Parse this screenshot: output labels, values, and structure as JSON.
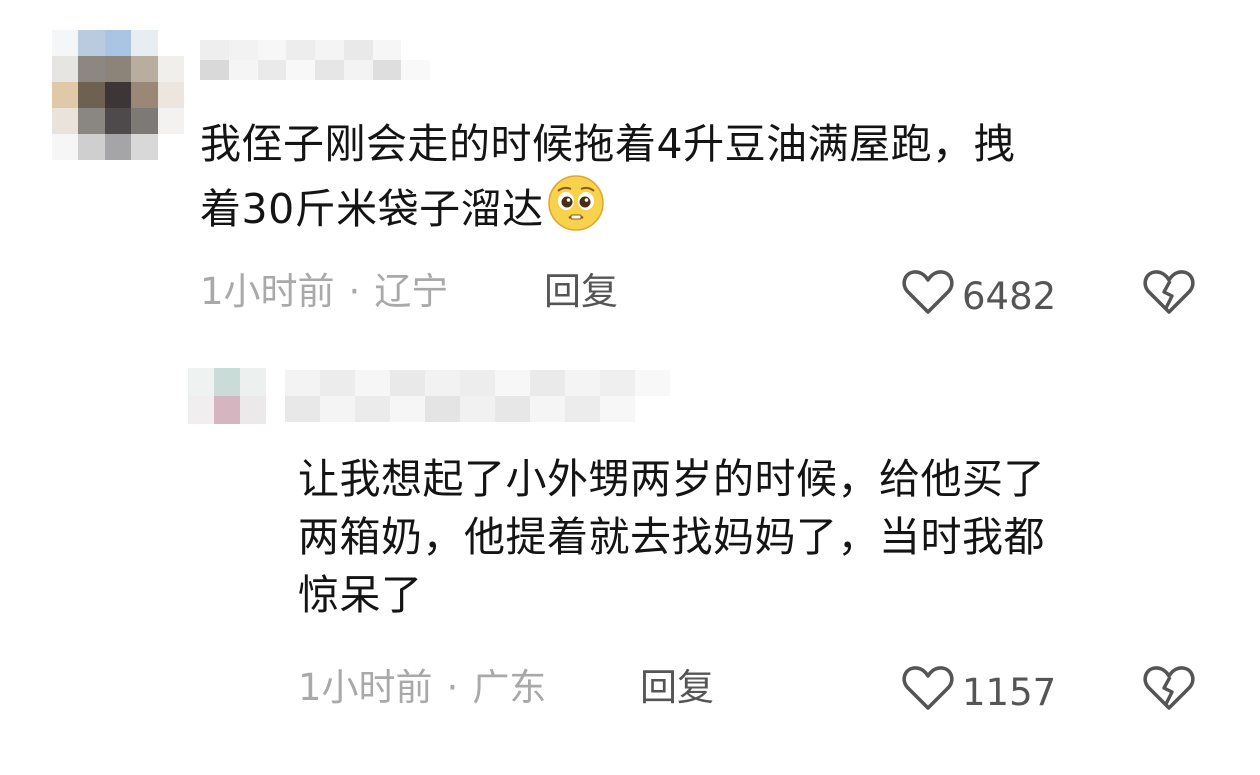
{
  "comments": [
    {
      "text_line1": "我侄子刚会走的时候拖着4升豆油满屋跑，拽",
      "text_line2": "着30斤米袋子溜达",
      "emoji": "pleading-face-emoji",
      "time": "1小时前",
      "separator": "·",
      "location": "辽宁",
      "reply_label": "回复",
      "likes": "6482"
    },
    {
      "text_line1": "让我想起了小外甥两岁的时候，给他买了",
      "text_line2": "两箱奶，他提着就去找妈妈了，当时我都",
      "text_line3": "惊呆了",
      "time": "1小时前",
      "separator": "·",
      "location": "广东",
      "reply_label": "回复",
      "likes": "1157"
    }
  ],
  "icons": {
    "like": "heart-outline-icon",
    "dislike": "broken-heart-icon"
  },
  "colors": {
    "text": "#141414",
    "meta": "#a9a9a9",
    "action": "#555555"
  }
}
